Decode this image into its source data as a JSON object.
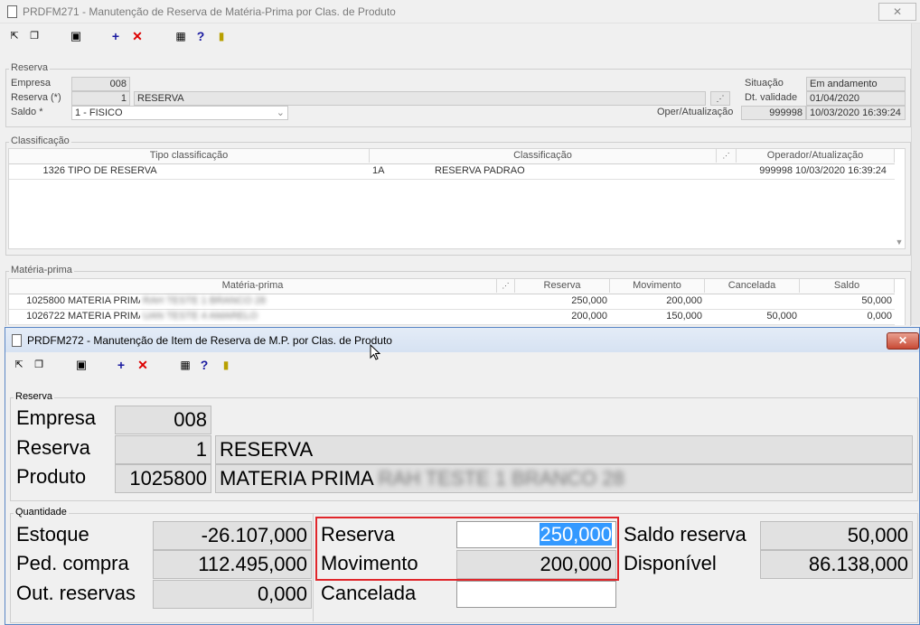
{
  "window1": {
    "title": "PRDFM271 - Manutenção de Reserva de Matéria-Prima por Clas. de Produto",
    "close_label": "✕",
    "reserva": {
      "group_label": "Reserva",
      "empresa_label": "Empresa",
      "empresa_value": "008",
      "reserva_label": "Reserva (*)",
      "reserva_code": "1",
      "reserva_desc": "RESERVA",
      "saldo_label": "Saldo *",
      "saldo_value": "1 - FISICO",
      "situacao_label": "Situação",
      "situacao_value": "Em andamento",
      "dt_validade_label": "Dt. validade",
      "dt_validade_value": "01/04/2020",
      "oper_label": "Oper/Atualização",
      "oper_user": "999998",
      "oper_datetime": "10/03/2020 16:39:24"
    },
    "classificacao": {
      "group_label": "Classificação",
      "headers": [
        "Tipo classificação",
        "Classificação",
        "Operador/Atualização"
      ],
      "row": {
        "tipo_code": "1326",
        "tipo_desc": "TIPO DE RESERVA",
        "class_code": "1A",
        "class_desc": "RESERVA PADRAO",
        "oper": "999998",
        "datetime": "10/03/2020 16:39:24"
      }
    },
    "materia_prima": {
      "group_label": "Matéria-prima",
      "headers": [
        "Matéria-prima",
        "Reserva",
        "Movimento",
        "Cancelada",
        "Saldo"
      ],
      "rows": [
        {
          "code": "1025800",
          "desc": "MATERIA PRIMA",
          "blur": "RAH TESTE 1 BRANCO 28",
          "reserva": "250,000",
          "movimento": "200,000",
          "cancelada": "",
          "saldo": "50,000"
        },
        {
          "code": "1026722",
          "desc": "MATERIA PRIMA",
          "blur": "UAN TESTE 4 AMARELO",
          "reserva": "200,000",
          "movimento": "150,000",
          "cancelada": "50,000",
          "saldo": "0,000"
        }
      ]
    }
  },
  "window2": {
    "title": "PRDFM272 - Manutenção de Item de Reserva de M.P. por Clas. de Produto",
    "close_label": "✕",
    "reserva": {
      "group_label": "Reserva",
      "empresa_label": "Empresa",
      "empresa_value": "008",
      "reserva_label": "Reserva",
      "reserva_code": "1",
      "reserva_desc": "RESERVA",
      "produto_label": "Produto",
      "produto_code": "1025800",
      "produto_desc": "MATERIA PRIMA",
      "produto_blur": "RAH TESTE 1 BRANCO 28"
    },
    "quantidade": {
      "group_label": "Quantidade",
      "estoque_label": "Estoque",
      "estoque_value": "-26.107,000",
      "ped_compra_label": "Ped. compra",
      "ped_compra_value": "112.495,000",
      "out_reservas_label": "Out. reservas",
      "out_reservas_value": "0,000",
      "reserva_label": "Reserva",
      "reserva_value": "250,000",
      "movimento_label": "Movimento",
      "movimento_value": "200,000",
      "cancelada_label": "Cancelada",
      "cancelada_value": "",
      "saldo_reserva_label": "Saldo reserva",
      "saldo_reserva_value": "50,000",
      "disponivel_label": "Disponível",
      "disponivel_value": "86.138,000"
    }
  },
  "toolbar_icons": [
    "exit-icon",
    "copy-icon",
    "save-icon",
    "add-icon",
    "delete-icon",
    "calendar-icon",
    "help-icon",
    "door-icon"
  ]
}
